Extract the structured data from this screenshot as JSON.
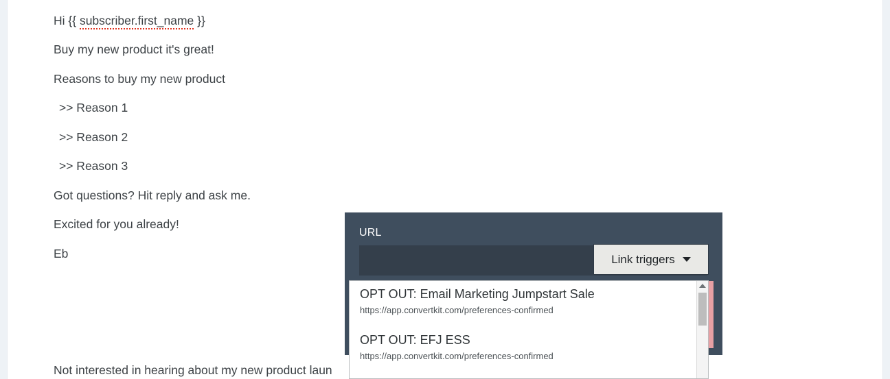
{
  "email": {
    "lines": [
      {
        "id": "greeting",
        "prefix": "Hi {{ ",
        "tag": "subscriber.first_name",
        "suffix": " }}"
      },
      {
        "id": "pitch",
        "text": "Buy my new product it's great!"
      },
      {
        "id": "reasons-heading",
        "text": "Reasons to buy my new product"
      },
      {
        "id": "reason-1",
        "text": ">> Reason 1"
      },
      {
        "id": "reason-2",
        "text": ">> Reason 2"
      },
      {
        "id": "reason-3",
        "text": ">> Reason 3"
      },
      {
        "id": "questions",
        "text": "Got questions? Hit reply and ask me."
      },
      {
        "id": "excited",
        "text": "Excited for you already!"
      },
      {
        "id": "signature",
        "text": "Eb"
      },
      {
        "id": "footer",
        "text": "Not interested in hearing about my new product laun"
      }
    ]
  },
  "link_modal": {
    "url_label": "URL",
    "url_value": "",
    "url_placeholder": "",
    "link_triggers_button": "Link triggers",
    "caret_icon": "chevron-down-icon",
    "background_color": "#3f4e5e",
    "input_background_color": "#343f4b"
  },
  "dropdown": {
    "items": [
      {
        "title": "OPT OUT: Email Marketing Jumpstart Sale",
        "url": "https://app.convertkit.com/preferences-confirmed"
      },
      {
        "title": "OPT OUT: EFJ ESS",
        "url": "https://app.convertkit.com/preferences-confirmed"
      }
    ],
    "scrollbar": {
      "up_arrow_icon": "scroll-up-arrow-icon",
      "thumb": "scrollbar-thumb"
    }
  },
  "theme": {
    "page_background": "#ffffff",
    "gutter_color": "#eef2f6",
    "body_text_color": "#3d4246",
    "merge_tag_underline_color": "#e0301e",
    "button_background": "#e9e9e6",
    "hidden_button_color": "#e8a0a4"
  }
}
